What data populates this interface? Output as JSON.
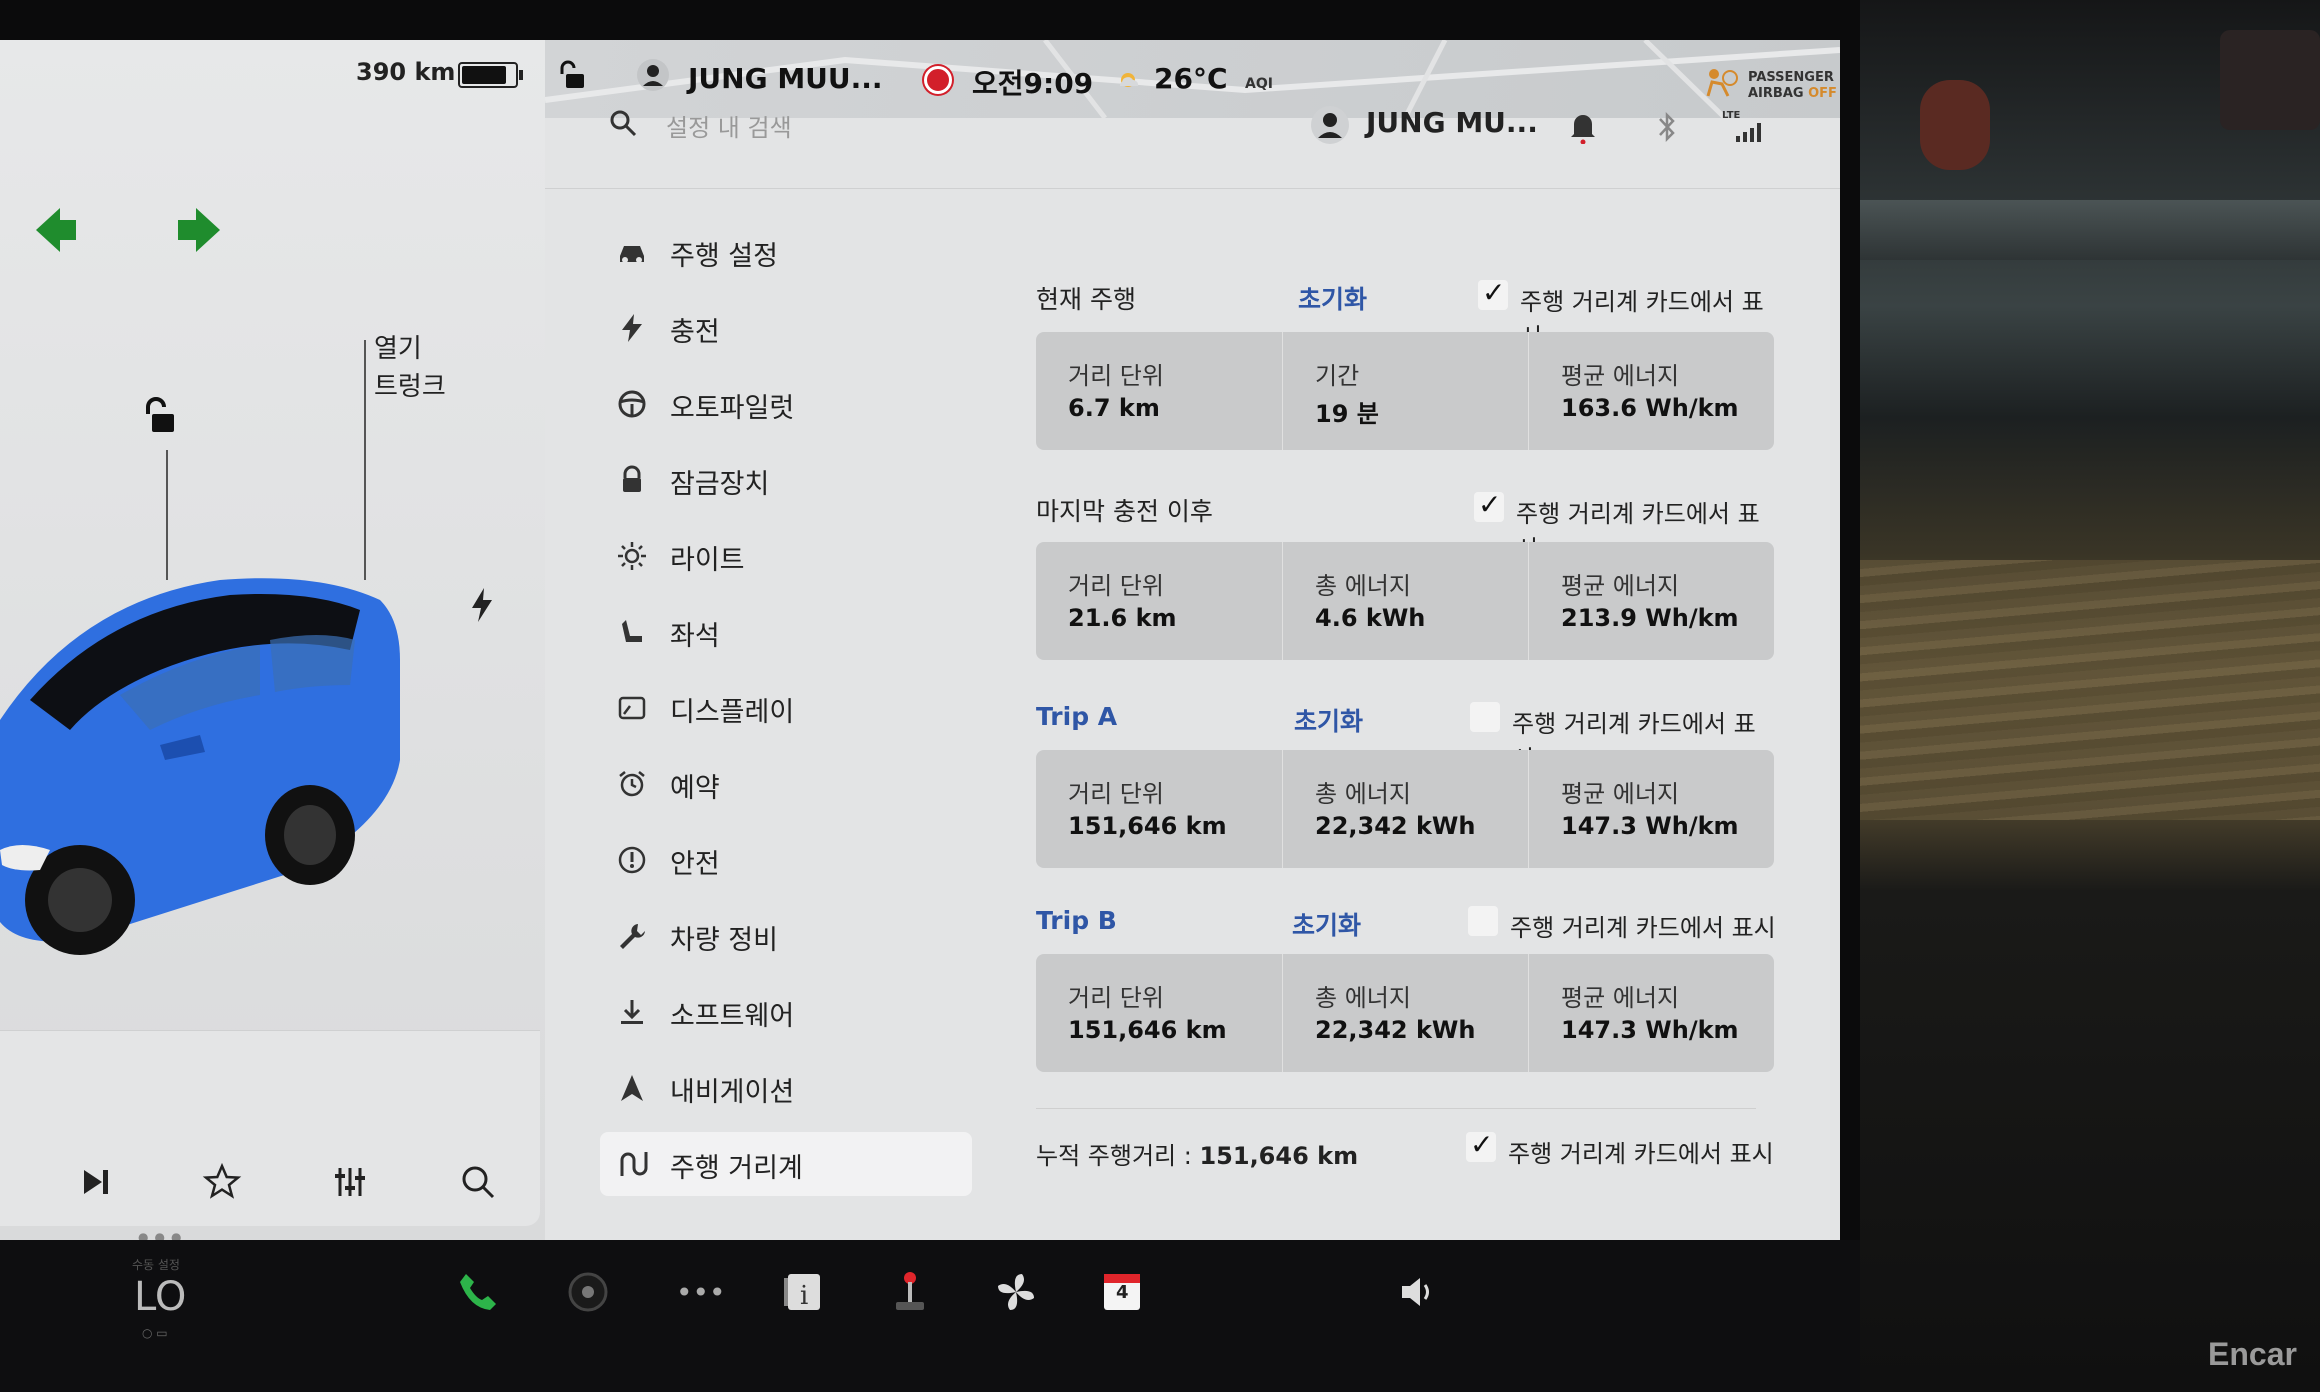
{
  "status": {
    "range": "390 km",
    "battery_level": 0.85,
    "driver_name": "JUNG MUU...",
    "time": "오전9:09",
    "temperature": "26°C",
    "aqi_label": "AQI",
    "airbag_line1": "PASSENGER",
    "airbag_line2": "AIRBAG",
    "airbag_state": "OFF"
  },
  "car_panel": {
    "open_label": "열기",
    "trunk_label": "트렁크"
  },
  "search": {
    "placeholder": "설정 내 검색"
  },
  "profile": {
    "name": "JUNG MU..."
  },
  "network": "LTE",
  "nav": {
    "items": [
      {
        "label": "주행 설정",
        "icon": "car-icon"
      },
      {
        "label": "충전",
        "icon": "bolt-icon"
      },
      {
        "label": "오토파일럿",
        "icon": "steering-wheel-icon"
      },
      {
        "label": "잠금장치",
        "icon": "lock-icon"
      },
      {
        "label": "라이트",
        "icon": "sun-icon"
      },
      {
        "label": "좌석",
        "icon": "seat-icon"
      },
      {
        "label": "디스플레이",
        "icon": "display-icon"
      },
      {
        "label": "예약",
        "icon": "alarm-icon"
      },
      {
        "label": "안전",
        "icon": "alert-icon"
      },
      {
        "label": "차량 정비",
        "icon": "wrench-icon"
      },
      {
        "label": "소프트웨어",
        "icon": "download-icon"
      },
      {
        "label": "내비게이션",
        "icon": "navigation-icon"
      },
      {
        "label": "주행 거리계",
        "icon": "odometer-icon"
      }
    ],
    "active_index": 12
  },
  "trips": {
    "current": {
      "title": "현재 주행",
      "reset": "초기화",
      "show_label": "주행 거리계 카드에서 표시",
      "checked": true,
      "cells": [
        {
          "k": "거리 단위",
          "v": "6.7 km"
        },
        {
          "k": "기간",
          "v": "19 분"
        },
        {
          "k": "평균 에너지",
          "v": "163.6 Wh/km"
        }
      ]
    },
    "since_charge": {
      "title": "마지막 충전 이후",
      "show_label": "주행 거리계 카드에서 표시",
      "checked": true,
      "cells": [
        {
          "k": "거리 단위",
          "v": "21.6 km"
        },
        {
          "k": "총 에너지",
          "v": "4.6 kWh"
        },
        {
          "k": "평균 에너지",
          "v": "213.9 Wh/km"
        }
      ]
    },
    "trip_a": {
      "title": "Trip A",
      "reset": "초기화",
      "show_label": "주행 거리계 카드에서 표시",
      "checked": false,
      "cells": [
        {
          "k": "거리 단위",
          "v": "151,646 km"
        },
        {
          "k": "총 에너지",
          "v": "22,342 kWh"
        },
        {
          "k": "평균 에너지",
          "v": "147.3 Wh/km"
        }
      ]
    },
    "trip_b": {
      "title": "Trip B",
      "reset": "초기화",
      "show_label": "주행 거리계 카드에서 표시",
      "checked": false,
      "cells": [
        {
          "k": "거리 단위",
          "v": "151,646 km"
        },
        {
          "k": "총 에너지",
          "v": "22,342 kWh"
        },
        {
          "k": "평균 에너지",
          "v": "147.3 Wh/km"
        }
      ]
    }
  },
  "odometer": {
    "label": "누적 주행거리 :",
    "value": "151,646 km",
    "show_label": "주행 거리계 카드에서 표시",
    "checked": true
  },
  "dock": {
    "temp_label": "수동 설정",
    "temp": "LO",
    "calendar_day": "4"
  },
  "watermark": "Encar",
  "colors": {
    "accent_blue": "#2f56a6",
    "turn_signal_green": "#1f8c2d",
    "record_red": "#d21f2a",
    "car_blue": "#2f6fe0"
  }
}
